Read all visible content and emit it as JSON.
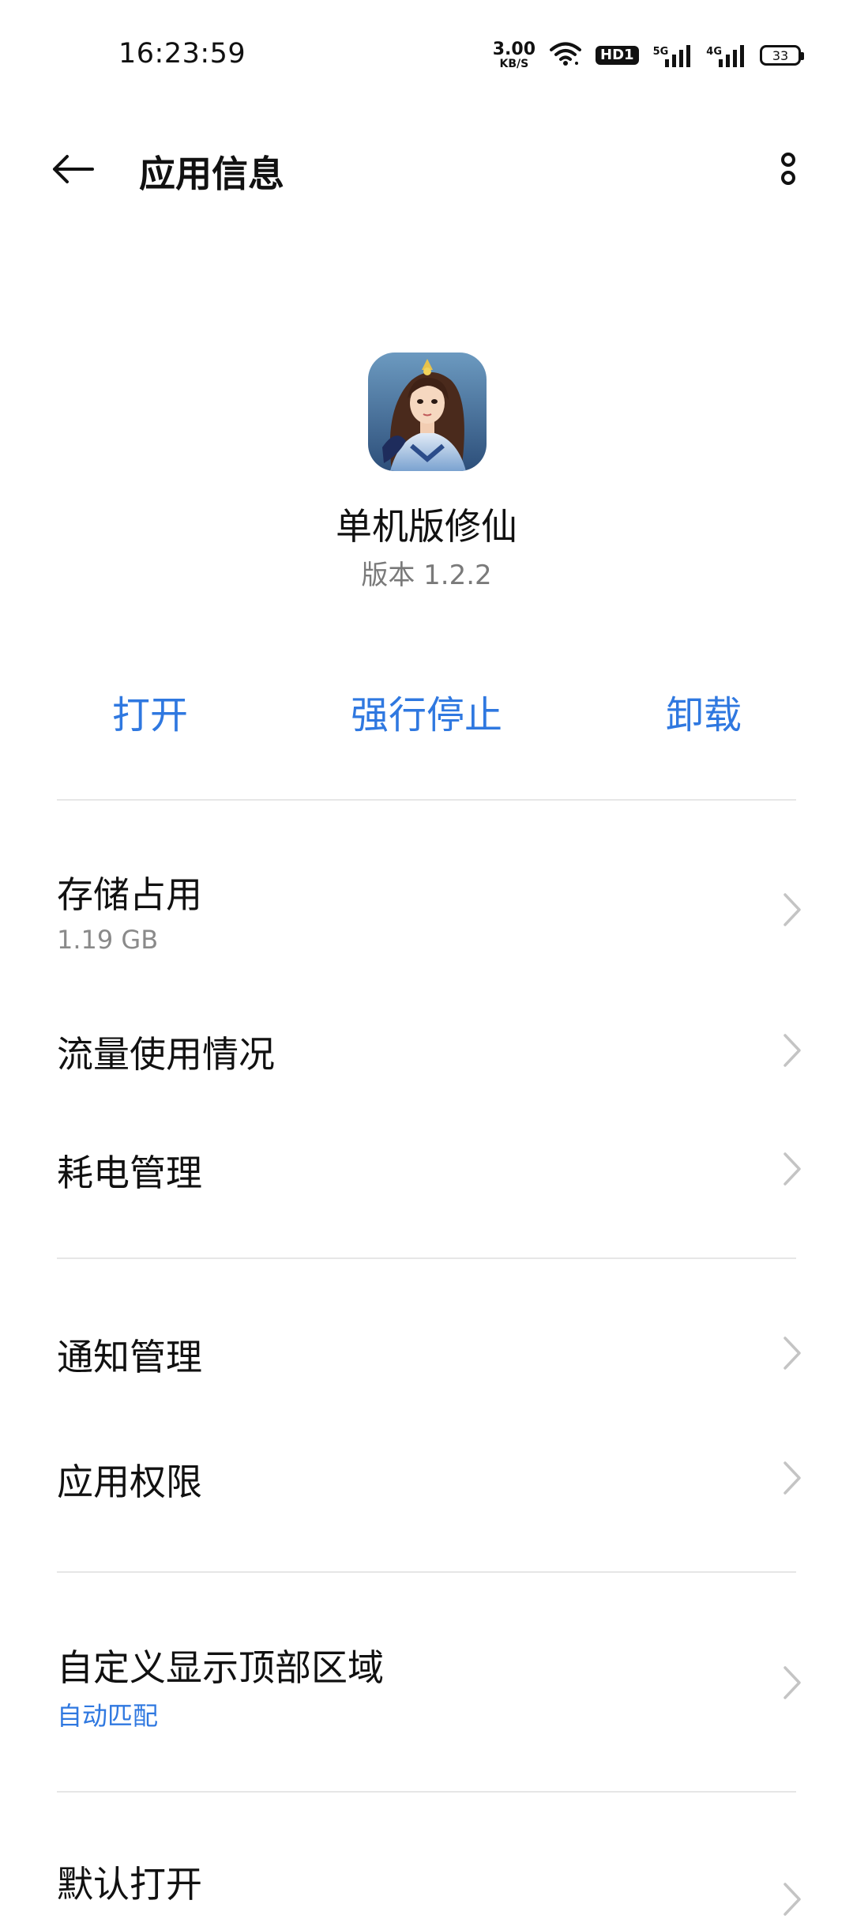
{
  "status_bar": {
    "time": "16:23:59",
    "net_speed_value": "3.00",
    "net_speed_unit": "KB/S",
    "hd_label": "HD1",
    "sim1_label": "5G",
    "sim2_label": "4G",
    "battery": "33"
  },
  "header": {
    "title": "应用信息"
  },
  "app": {
    "name": "单机版修仙",
    "version": "版本 1.2.2"
  },
  "actions": {
    "open": "打开",
    "force_stop": "强行停止",
    "uninstall": "卸载"
  },
  "items": {
    "storage": {
      "title": "存储占用",
      "subtitle": "1.19 GB"
    },
    "data_usage": {
      "title": "流量使用情况"
    },
    "power": {
      "title": "耗电管理"
    },
    "notifications": {
      "title": "通知管理"
    },
    "permissions": {
      "title": "应用权限"
    },
    "display_top": {
      "title": "自定义显示顶部区域",
      "subtitle": "自动匹配"
    },
    "default_open": {
      "title": "默认打开"
    }
  },
  "colors": {
    "accent": "#2f78e0",
    "text": "#111111",
    "secondary": "#7a7a7a",
    "divider": "#e6e6e6"
  }
}
